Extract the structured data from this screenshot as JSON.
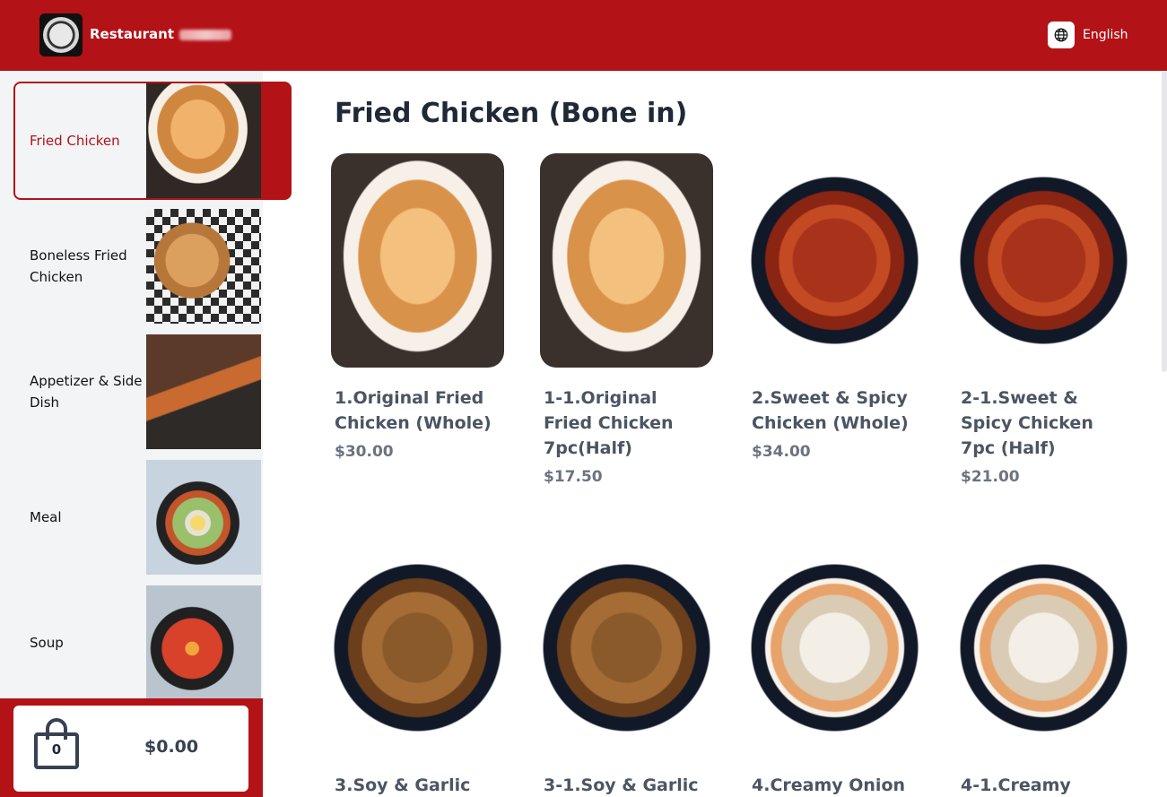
{
  "header": {
    "brand": "Restaurant",
    "language_label": "English",
    "colors": {
      "primary": "#b31217",
      "text_on_primary": "#ffffff"
    }
  },
  "sidebar": {
    "categories": [
      {
        "label": "Fried Chicken",
        "icon": "fried-chicken-photo",
        "active": true
      },
      {
        "label": "Boneless Fried Chicken",
        "icon": "boneless-chicken-photo",
        "active": false
      },
      {
        "label": "Appetizer & Side Dish",
        "icon": "appetizer-photo",
        "active": false
      },
      {
        "label": "Meal",
        "icon": "bibimbap-photo",
        "active": false
      },
      {
        "label": "Soup",
        "icon": "stew-photo",
        "active": false
      }
    ]
  },
  "cart": {
    "count": "0",
    "total": "$0.00",
    "icon": "shopping-bag-icon"
  },
  "main": {
    "section_title": "Fried Chicken (Bone in)",
    "items": [
      {
        "name": "1.Original Fried Chicken (Whole)",
        "price": "$30.00",
        "photo": "original-fried-chicken"
      },
      {
        "name": "1-1.Original Fried Chicken 7pc(Half)",
        "price": "$17.50",
        "photo": "original-fried-chicken"
      },
      {
        "name": "2.Sweet & Spicy Chicken (Whole)",
        "price": "$34.00",
        "photo": "sweet-spicy-chicken"
      },
      {
        "name": "2-1.Sweet & Spicy Chicken 7pc (Half)",
        "price": "$21.00",
        "photo": "sweet-spicy-chicken"
      },
      {
        "name": "3.Soy & Garlic",
        "price": "",
        "photo": "soy-garlic-chicken"
      },
      {
        "name": "3-1.Soy & Garlic",
        "price": "",
        "photo": "soy-garlic-chicken"
      },
      {
        "name": "4.Creamy Onion",
        "price": "",
        "photo": "creamy-onion-chicken"
      },
      {
        "name": "4-1.Creamy",
        "price": "",
        "photo": "creamy-onion-chicken"
      }
    ]
  }
}
